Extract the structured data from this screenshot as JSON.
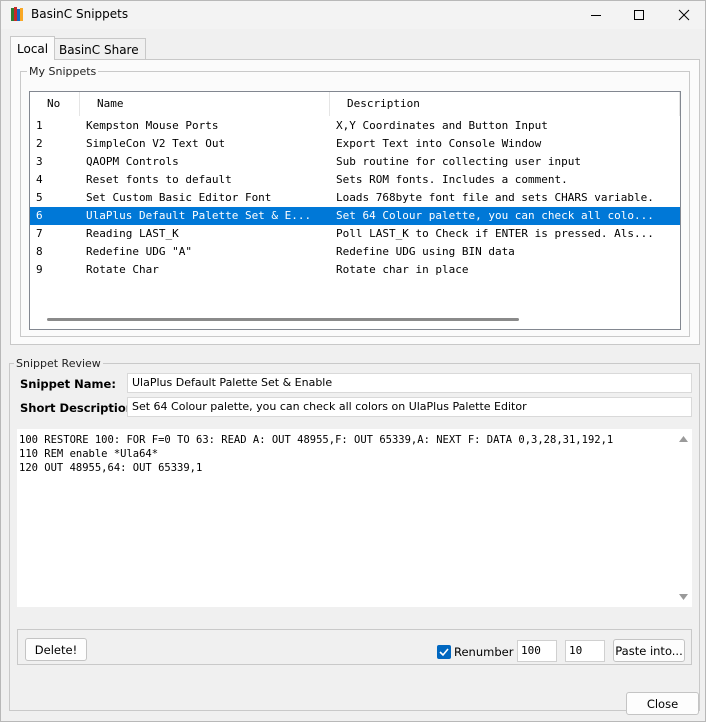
{
  "window": {
    "title": "BasinC Snippets",
    "controls": {
      "minimize_icon": "minimize-icon",
      "maximize_icon": "maximize-icon",
      "close_icon": "close-icon"
    }
  },
  "tabs": [
    {
      "label": "Local",
      "active": true
    },
    {
      "label": "BasinC Share",
      "active": false
    }
  ],
  "my_snippets": {
    "legend": "My Snippets",
    "columns": [
      "No",
      "Name",
      "Description"
    ],
    "rows": [
      {
        "no": "1",
        "name": "Kempston Mouse Ports",
        "description": "X,Y Coordinates and Button Input"
      },
      {
        "no": "2",
        "name": "SimpleCon V2 Text Out",
        "description": "Export Text into Console Window"
      },
      {
        "no": "3",
        "name": "QAOPM Controls",
        "description": "Sub routine for collecting user input"
      },
      {
        "no": "4",
        "name": "Reset fonts to default",
        "description": "Sets ROM fonts. Includes a comment."
      },
      {
        "no": "5",
        "name": "Set Custom Basic Editor Font",
        "description": "Loads 768byte font file and sets CHARS variable."
      },
      {
        "no": "6",
        "name": "UlaPlus Default Palette Set & E...",
        "description": "Set 64 Colour palette, you can check all colo..."
      },
      {
        "no": "7",
        "name": "Reading LAST_K",
        "description": "Poll LAST_K to Check if ENTER is pressed. Als..."
      },
      {
        "no": "8",
        "name": "Redefine UDG \"A\"",
        "description": "Redefine UDG using BIN data"
      },
      {
        "no": "9",
        "name": "Rotate Char",
        "description": "Rotate char in place"
      }
    ],
    "selected_index": 5
  },
  "review": {
    "legend": "Snippet Review",
    "name_label": "Snippet Name:",
    "name_value": "UlaPlus Default Palette Set & Enable",
    "desc_label": "Short Description",
    "desc_value": "Set 64 Colour palette, you can check all colors on UlaPlus Palette Editor",
    "code_lines": [
      "100 RESTORE 100: FOR F=0 TO 63: READ A: OUT 48955,F: OUT 65339,A: NEXT F: DATA 0,3,28,31,192,1",
      "110 REM enable *Ula64*",
      "120 OUT 48955,64: OUT 65339,1"
    ]
  },
  "actions": {
    "delete_label": "Delete!",
    "renumber_label": "Renumber",
    "renumber_checked": true,
    "start_value": "100",
    "step_value": "10",
    "paste_label": "Paste into...",
    "close_label": "Close"
  },
  "colors": {
    "selection": "#0078d7",
    "checkbox": "#0067c0"
  }
}
